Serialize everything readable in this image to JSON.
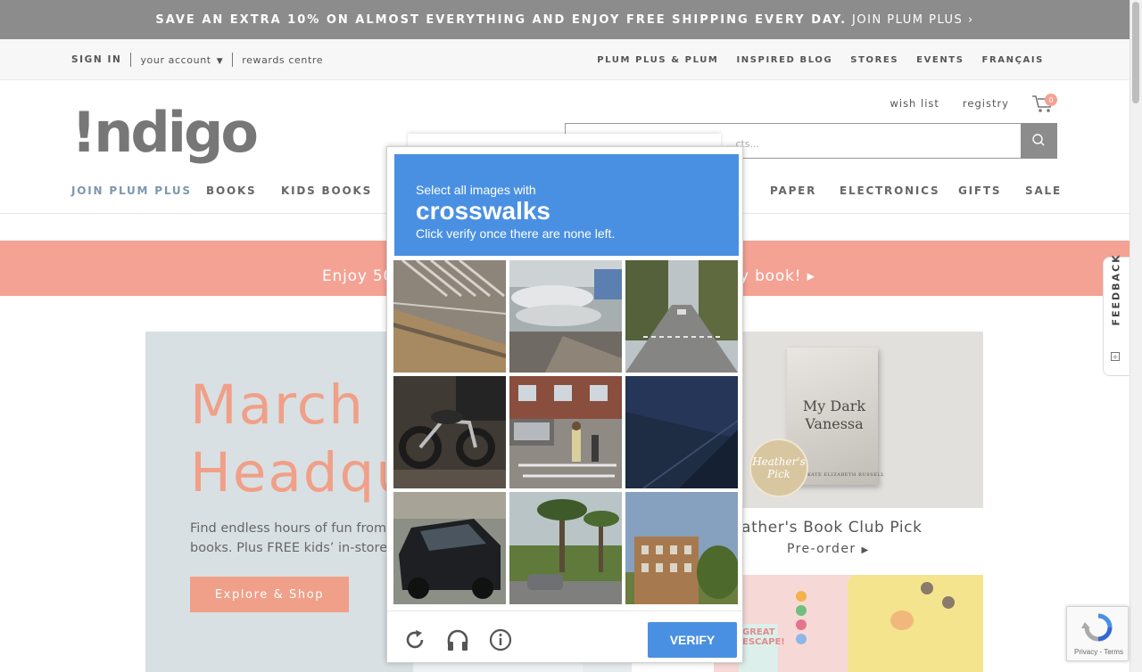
{
  "promo": {
    "text": "SAVE AN EXTRA 10% ON ALMOST EVERYTHING AND ENJOY FREE SHIPPING EVERY DAY.",
    "link": "JOIN PLUM PLUS",
    "link_arrow": "›"
  },
  "utility": {
    "sign_in": "SIGN IN",
    "your_account": "your account",
    "account_caret": "▼",
    "rewards": "rewards centre",
    "right_links": [
      "PLUM PLUS & PLUM",
      "INSPIRED BLOG",
      "STORES",
      "EVENTS",
      "FRANÇAIS"
    ]
  },
  "header": {
    "logo": "!ndigo",
    "wish_list": "wish list",
    "registry": "registry",
    "cart_count": "0",
    "search_placeholder": "...cts..."
  },
  "nav": {
    "items": [
      "JOIN PLUM PLUS",
      "BOOKS",
      "KIDS BOOKS",
      "PAPER",
      "ELECTRONICS",
      "GIFTS",
      "SALE"
    ]
  },
  "banner": {
    "left_text": "Enjoy 50",
    "right_text": "y book! ▸"
  },
  "hero": {
    "title_line1": "March I",
    "title_line2": "Headqu",
    "text_line1": "Find endless hours of fun from",
    "text_line2": "books. Plus FREE kids’ in-store",
    "button": "Explore & Shop"
  },
  "book_card": {
    "book_title": "My Dark Vanessa",
    "author": "KATE ELIZABETH RUSSELL",
    "seal": "Heather's Pick",
    "title": "eather's Book Club Pick",
    "cta": "Pre-order",
    "cta_arrow": "▶"
  },
  "card2": {
    "book_text": "GREAT ESCAPE!"
  },
  "feedback": {
    "label": "FEEDBACK",
    "icon": "+"
  },
  "captcha": {
    "line1": "Select all images with",
    "keyword": "crosswalks",
    "line3": "Click verify once there are none left.",
    "tiles": [
      {
        "name": "tile-1",
        "desc": "road-with-crosswalk-lines"
      },
      {
        "name": "tile-2",
        "desc": "boats-on-trailers"
      },
      {
        "name": "tile-3",
        "desc": "tree-lined-street"
      },
      {
        "name": "tile-4",
        "desc": "parked-motorcycle"
      },
      {
        "name": "tile-5",
        "desc": "pedestrians-crossing"
      },
      {
        "name": "tile-6",
        "desc": "dark-car-window"
      },
      {
        "name": "tile-7",
        "desc": "black-suv"
      },
      {
        "name": "tile-8",
        "desc": "palm-trees-roadside"
      },
      {
        "name": "tile-9",
        "desc": "brick-building"
      }
    ],
    "verify": "VERIFY",
    "icons": [
      "reload-icon",
      "headphones-icon",
      "info-icon"
    ]
  },
  "recaptcha": {
    "terms": "Privacy - Terms"
  }
}
